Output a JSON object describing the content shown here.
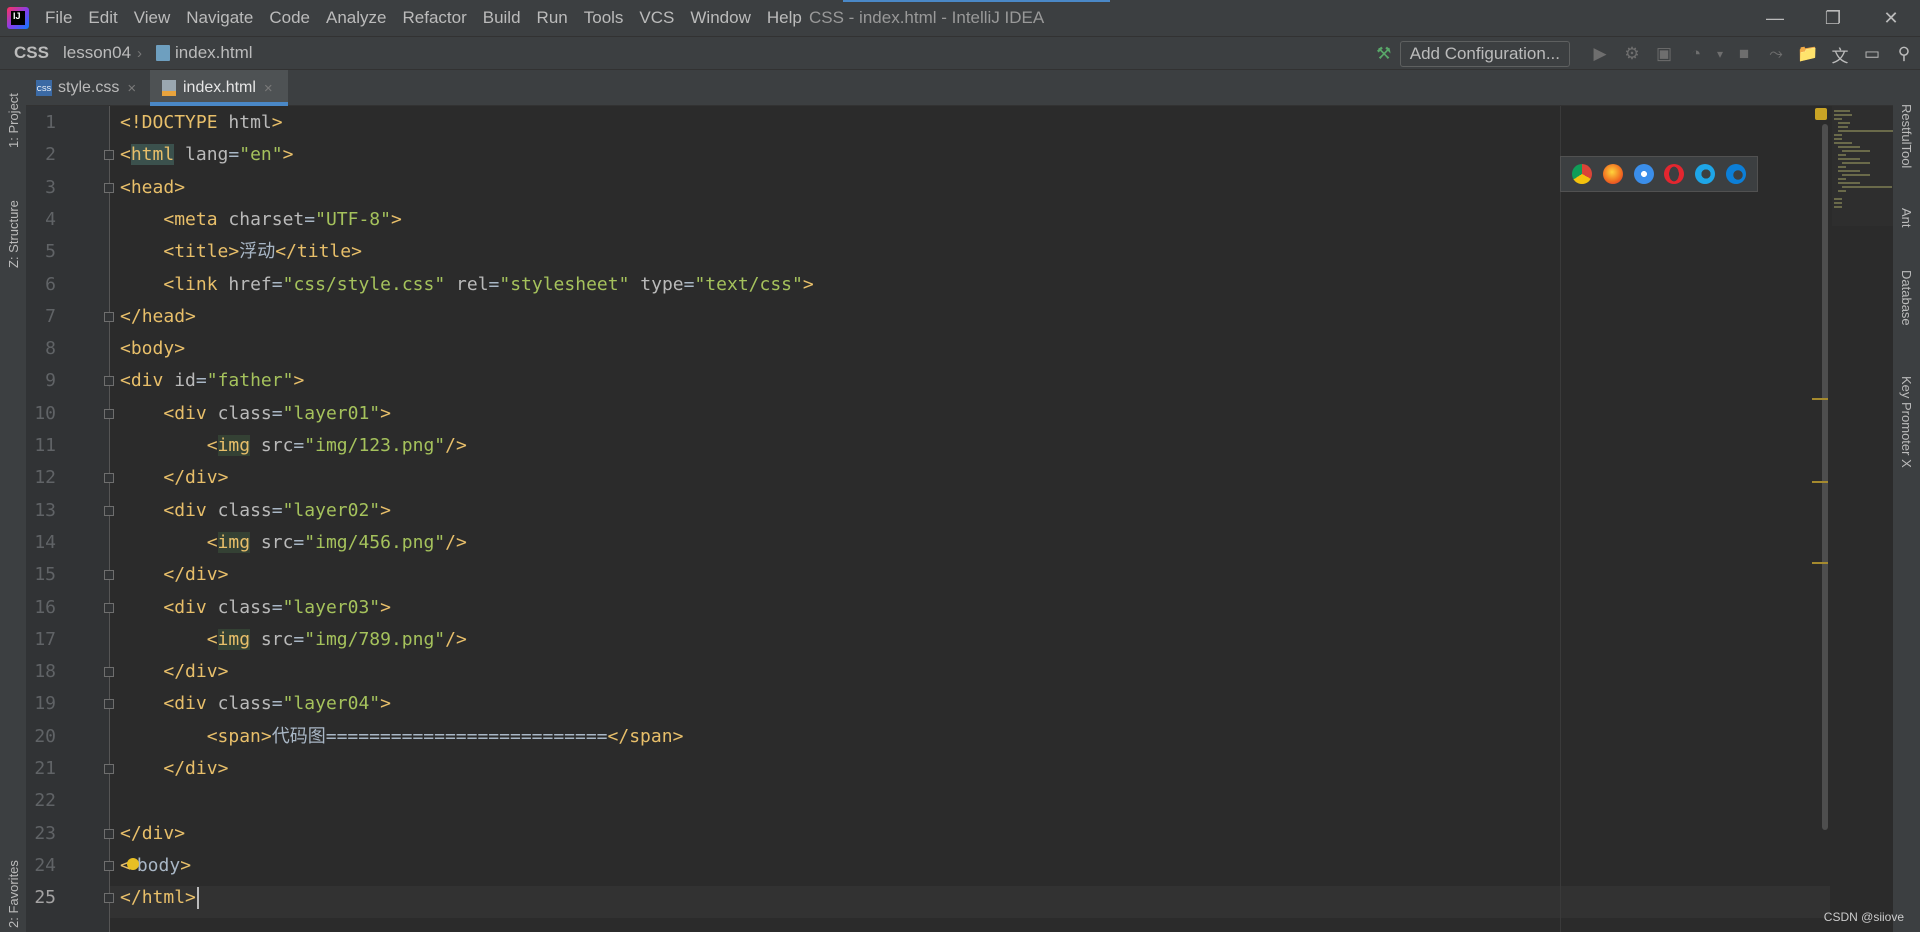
{
  "menu": {
    "items": [
      "File",
      "Edit",
      "View",
      "Navigate",
      "Code",
      "Analyze",
      "Refactor",
      "Build",
      "Run",
      "Tools",
      "VCS",
      "Window",
      "Help"
    ],
    "window_title": "CSS - index.html - IntelliJ IDEA"
  },
  "breadcrumb": {
    "project": "CSS",
    "folder": "lesson04",
    "file": "index.html"
  },
  "toolbar": {
    "add_configuration": "Add Configuration..."
  },
  "tabs": [
    {
      "label": "style.css",
      "icon": "css-file-icon",
      "selected": false
    },
    {
      "label": "index.html",
      "icon": "html-file-icon",
      "selected": true
    }
  ],
  "side_panels": {
    "left": [
      "1: Project",
      "Z: Structure",
      "2: Favorites"
    ],
    "right": [
      "RestfulTool",
      "Ant",
      "Database",
      "Key Promoter X"
    ]
  },
  "editor": {
    "current_line": 25,
    "line_numbers": [
      "1",
      "2",
      "3",
      "4",
      "5",
      "6",
      "7",
      "8",
      "9",
      "10",
      "11",
      "12",
      "13",
      "14",
      "15",
      "16",
      "17",
      "18",
      "19",
      "20",
      "21",
      "22",
      "23",
      "24",
      "25"
    ],
    "lines": [
      "<!DOCTYPE html>",
      "<html lang=\"en\">",
      "<head>",
      "    <meta charset=\"UTF-8\">",
      "    <title>浮动</title>",
      "    <link href=\"css/style.css\" rel=\"stylesheet\" type=\"text/css\">",
      "</head>",
      "<body>",
      "<div id=\"father\">",
      "    <div class=\"layer01\">",
      "        <img src=\"img/123.png\"/>",
      "    </div>",
      "    <div class=\"layer02\">",
      "        <img src=\"img/456.png\"/>",
      "    </div>",
      "    <div class=\"layer03\">",
      "        <img src=\"img/789.png\"/>",
      "    </div>",
      "    <div class=\"layer04\">",
      "        <span>代码图==========================</span>",
      "    </div>",
      "",
      "</div>",
      "</body>",
      "</html>"
    ]
  },
  "browser_icons": [
    "chrome-icon",
    "firefox-icon",
    "safari-icon",
    "opera-icon",
    "internet-explorer-icon",
    "edge-icon"
  ],
  "watermark": "CSDN @siiove",
  "colors": {
    "background": "#2b2b2b",
    "tag": "#e8bf6a",
    "attribute_value": "#a5c25c",
    "accent": "#4a88c7"
  }
}
